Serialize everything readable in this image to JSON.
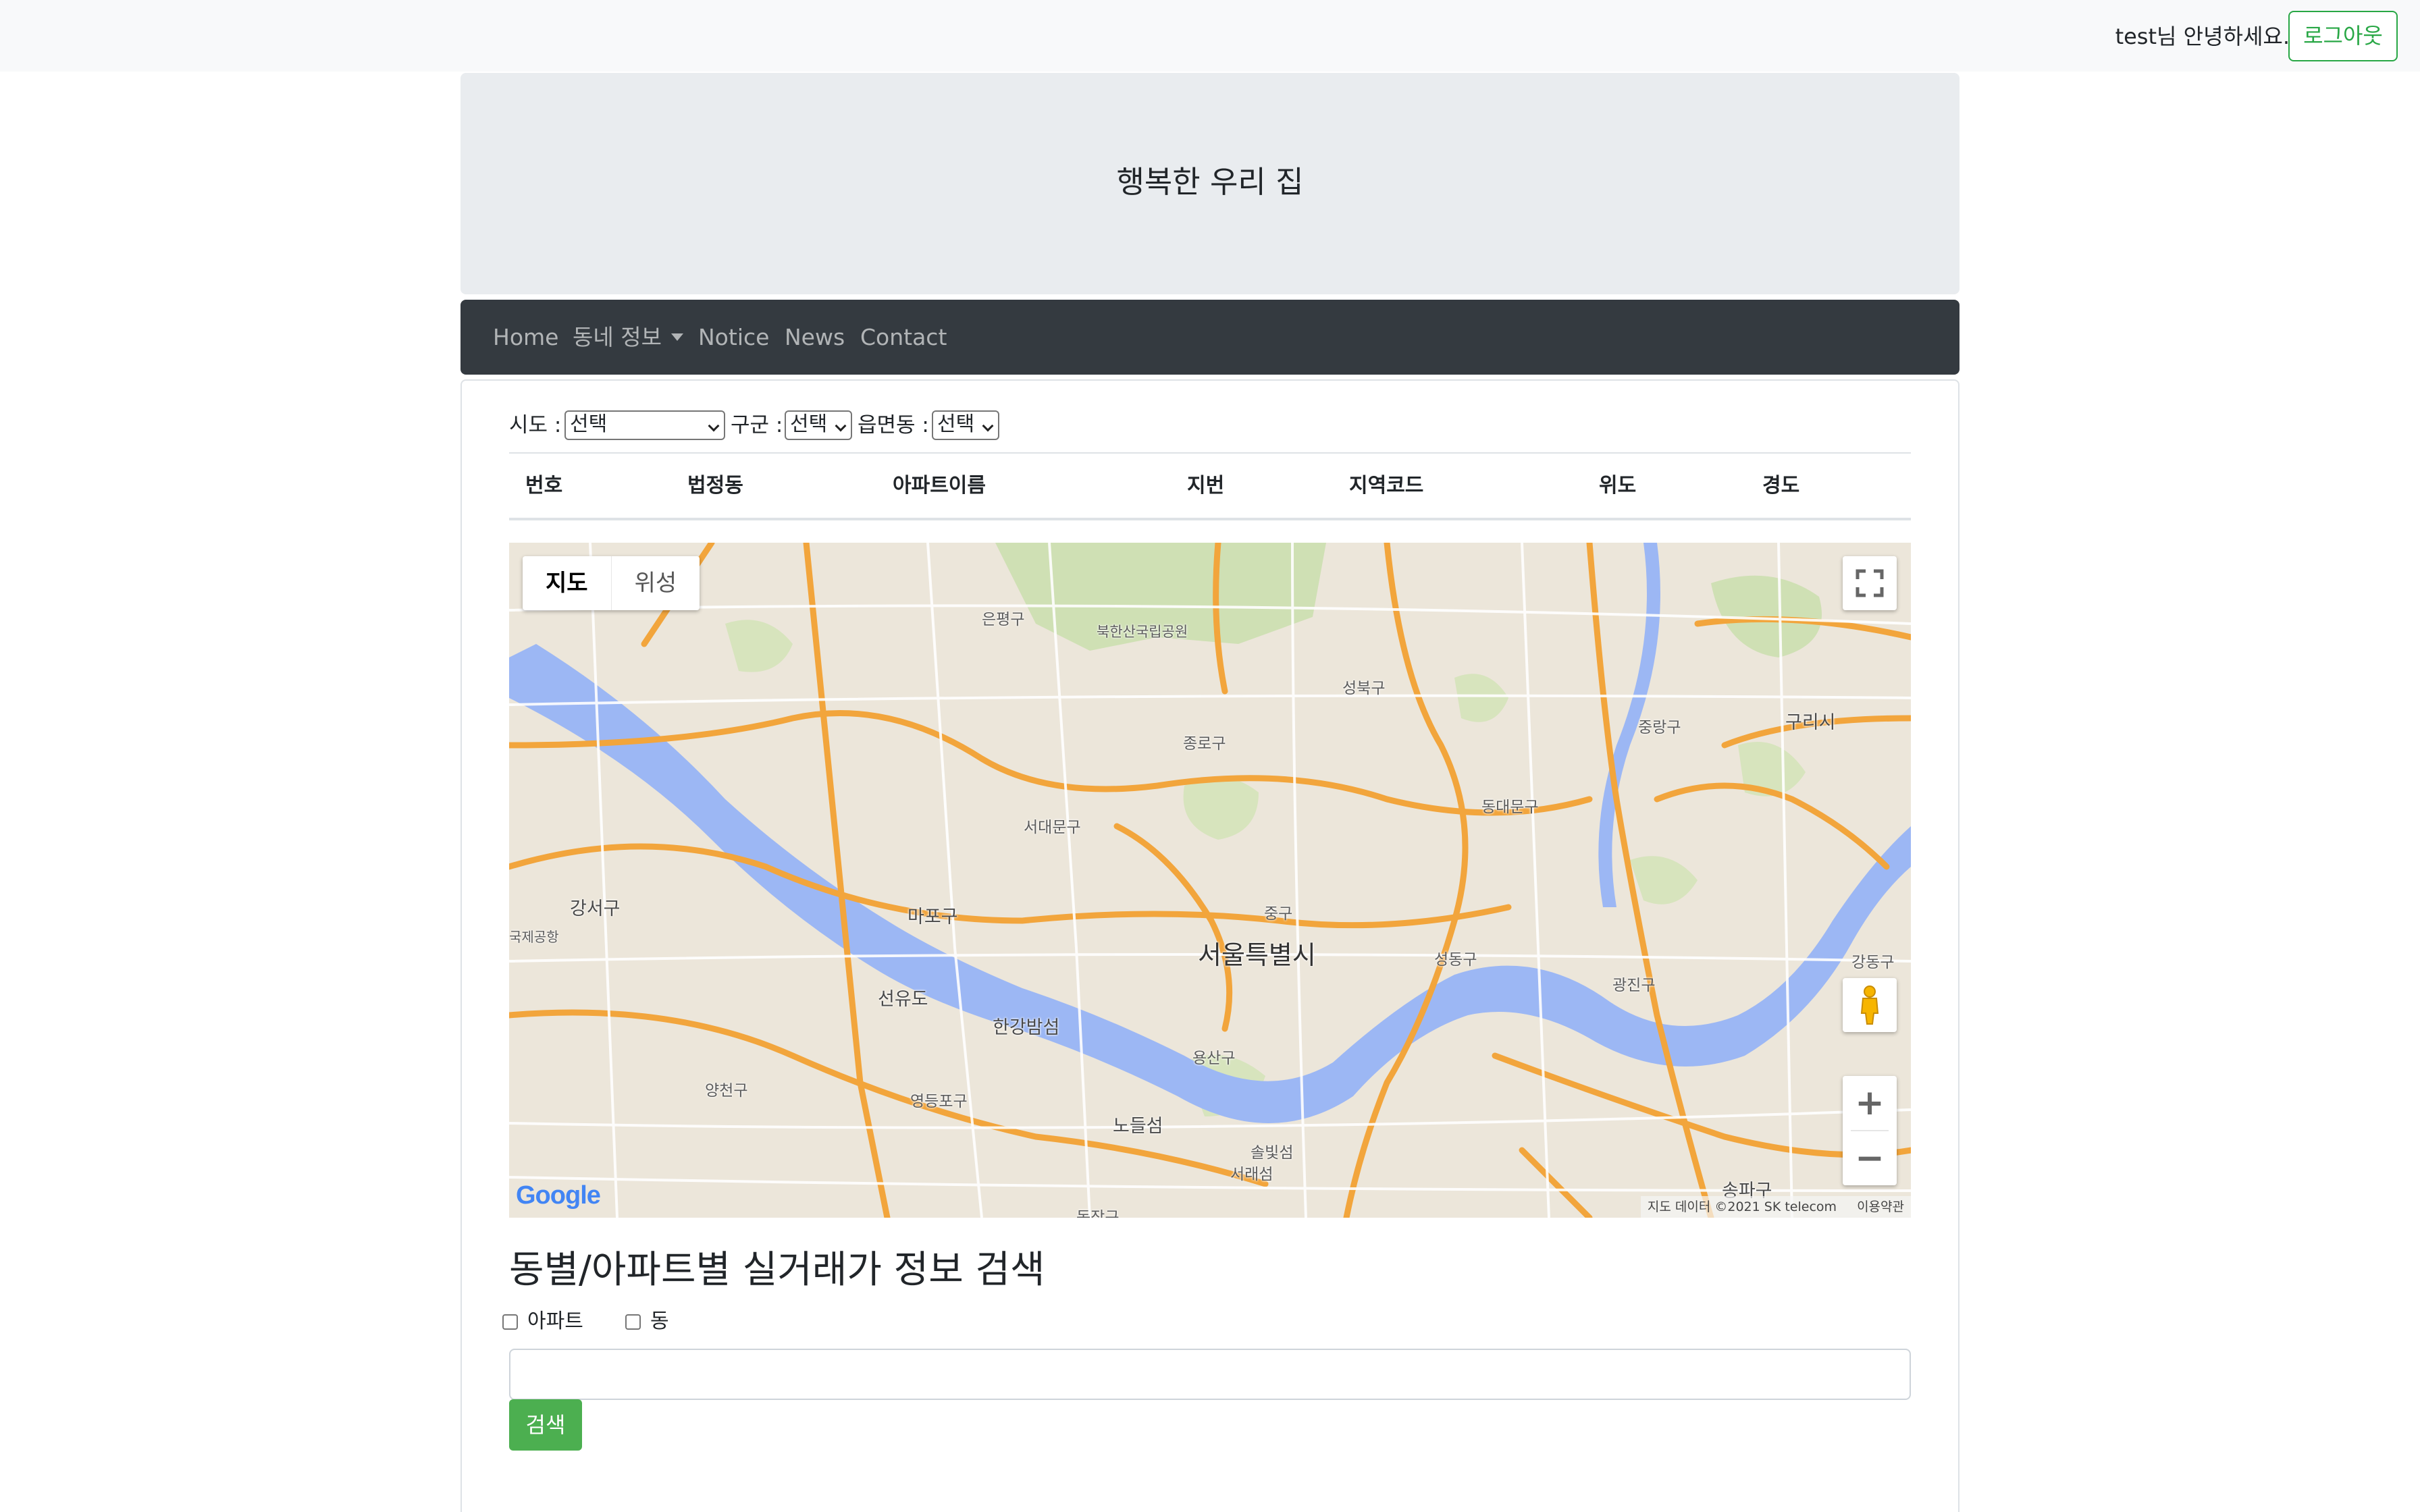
{
  "header": {
    "greeting": "test님 안녕하세요.",
    "logout_label": "로그아웃",
    "accent_color": "#28a745"
  },
  "jumbotron": {
    "title": "행복한 우리 집"
  },
  "navbar": {
    "items": [
      {
        "label": "Home"
      },
      {
        "label": "동네 정보",
        "dropdown": true
      },
      {
        "label": "Notice"
      },
      {
        "label": "News"
      },
      {
        "label": "Contact"
      }
    ]
  },
  "filters": {
    "sido_label": "시도 :",
    "sido_value": "선택",
    "gugun_label": "구군 :",
    "gugun_value": "선택",
    "dong_label": "읍면동 :",
    "dong_value": "선택"
  },
  "table": {
    "columns": [
      "번호",
      "법정동",
      "아파트이름",
      "지번",
      "지역코드",
      "위도",
      "경도"
    ],
    "rows": []
  },
  "map": {
    "type_buttons": [
      "지도",
      "위성"
    ],
    "active_type": "지도",
    "labels": {
      "city": "서울특별시",
      "eunpyeong": "은평구",
      "bukhansan": "북한산국립공원",
      "seongbuk": "성북구",
      "jungnang": "중랑구",
      "guri": "구리시",
      "jongno": "종로구",
      "dongdaemun": "동대문구",
      "seodaemun": "서대문구",
      "gangseo": "강서구",
      "airport": "국제공항",
      "mapo": "마포구",
      "jung": "중구",
      "seongdong": "성동구",
      "gwangjin": "광진구",
      "gangdong": "강동구",
      "seonyudo": "선유도",
      "hangang_park": "한강밤섬",
      "yongsan": "용산구",
      "yangcheon": "양천구",
      "yeongdeungpo": "영등포구",
      "nodeulseom": "노들섬",
      "seobinggo": "솔빛섬",
      "seorae": "서래섬",
      "songpa": "송파구",
      "dongjak": "동작구"
    },
    "logo": "Google",
    "attribution": "지도 데이터 ©2021 SK telecom",
    "terms": "이용약관",
    "zoom_in": "+",
    "zoom_out": "−"
  },
  "search": {
    "title": "동별/아파트별 실거래가 정보 검색",
    "option_apartment": "아파트",
    "option_dong": "동",
    "query": "",
    "button_label": "검색",
    "button_color": "#4caf50"
  }
}
